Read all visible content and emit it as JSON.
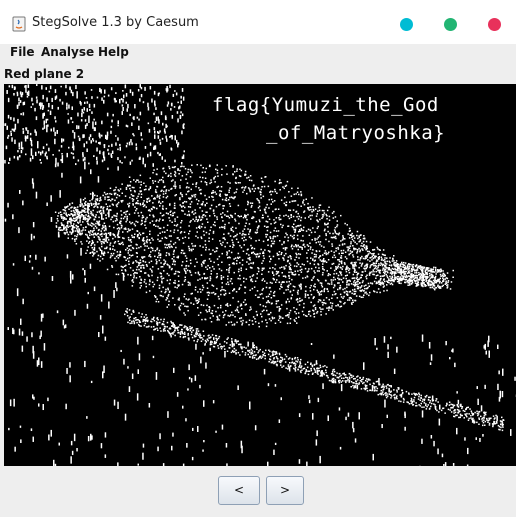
{
  "window": {
    "title": "StegSolve 1.3 by Caesum",
    "buttons": [
      {
        "name": "minimize",
        "color": "#00bcd4"
      },
      {
        "name": "maximize",
        "color": "#22b573"
      },
      {
        "name": "close",
        "color": "#e8315b"
      }
    ]
  },
  "menu": {
    "items": [
      "File",
      "Analyse",
      "Help"
    ]
  },
  "view": {
    "plane_label": "Red plane 2",
    "image_text_line1": "flag{Yumuzi_the_God",
    "image_text_line2": "_of_Matryoshka}"
  },
  "nav": {
    "prev_label": "<",
    "next_label": ">"
  }
}
